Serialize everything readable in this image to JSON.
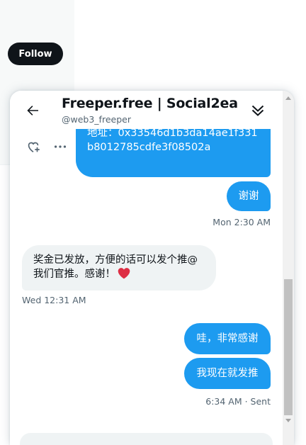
{
  "background": {
    "follow_label": "Follow"
  },
  "chat": {
    "title": "Freeper.free | Social2ea...",
    "handle": "@web3_freeper",
    "messages": {
      "address": "地址：0x33546d1b3da14ae1f331b8012785cdfe3f08502a",
      "xiexie": "谢谢",
      "time1": "Mon 2:30 AM",
      "reward": "奖金已发放，方便的话可以发个推@我们官推。感谢！",
      "time2": "Wed 12:31 AM",
      "wa": "哇，非常感谢",
      "fatui": "我现在就发推",
      "time3": "6:34 AM · Sent"
    }
  },
  "colors": {
    "accent": "#1d9bf0",
    "heart": "#f4212e",
    "text": "#0f1419",
    "muted": "#536471"
  },
  "icons": [
    "back-arrow-icon",
    "collapse-chevrons-icon",
    "add-reaction-icon",
    "more-icon",
    "red-heart-icon"
  ]
}
